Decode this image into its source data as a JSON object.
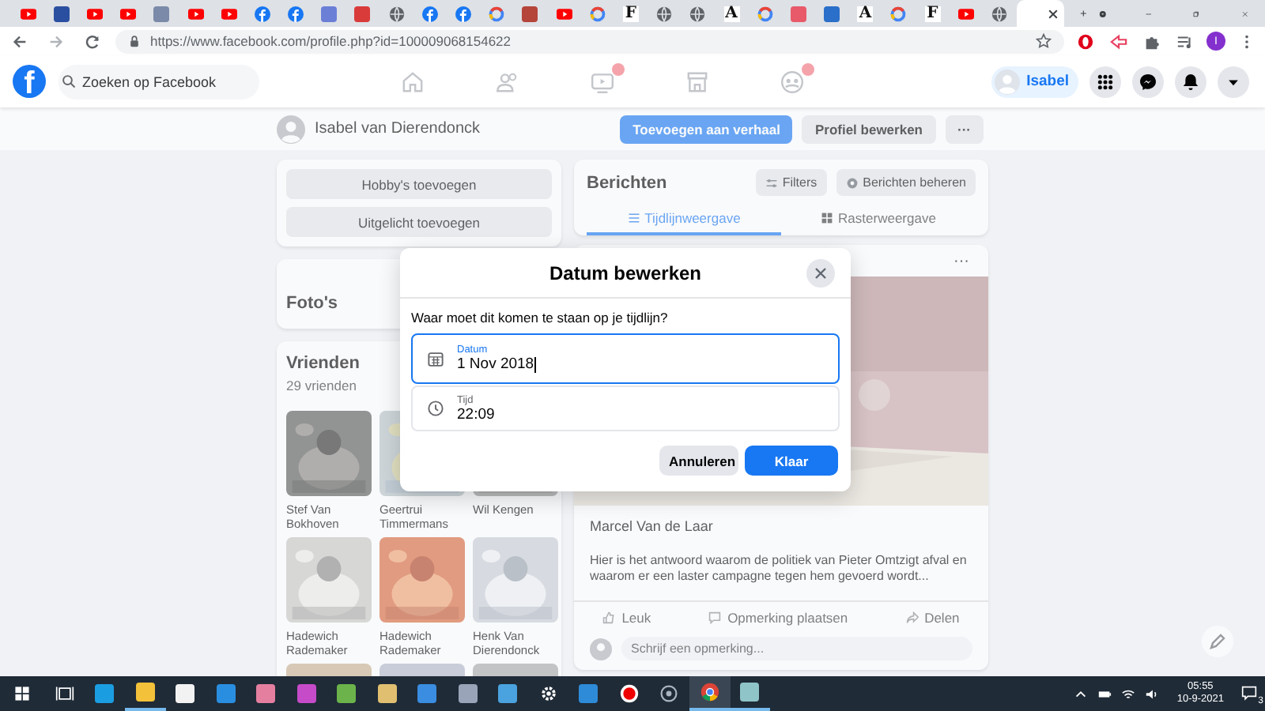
{
  "browser": {
    "tabs": [
      {
        "kind": "youtube",
        "selected": false
      },
      {
        "kind": "app",
        "color": "#2b4fa0",
        "selected": false
      },
      {
        "kind": "youtube",
        "selected": false
      },
      {
        "kind": "youtube",
        "selected": false
      },
      {
        "kind": "app",
        "color": "#7a8aa8",
        "selected": false
      },
      {
        "kind": "youtube",
        "selected": false
      },
      {
        "kind": "youtube",
        "selected": false
      },
      {
        "kind": "facebook",
        "selected": false
      },
      {
        "kind": "facebook",
        "selected": false
      },
      {
        "kind": "app",
        "color": "#6b7fd7",
        "selected": false
      },
      {
        "kind": "app",
        "color": "#d93b3b",
        "selected": false
      },
      {
        "kind": "globe",
        "selected": false
      },
      {
        "kind": "facebook",
        "selected": false
      },
      {
        "kind": "facebook",
        "selected": false
      },
      {
        "kind": "google",
        "selected": false
      },
      {
        "kind": "app",
        "color": "#b5443a",
        "selected": false
      },
      {
        "kind": "youtube",
        "selected": false
      },
      {
        "kind": "google",
        "selected": false
      },
      {
        "kind": "letter",
        "glyph": "F",
        "selected": false
      },
      {
        "kind": "globe",
        "selected": false
      },
      {
        "kind": "globe",
        "selected": false
      },
      {
        "kind": "letter",
        "glyph": "A",
        "selected": false
      },
      {
        "kind": "google",
        "selected": false
      },
      {
        "kind": "app",
        "color": "#e85a6a",
        "selected": false
      },
      {
        "kind": "app",
        "color": "#2a6fc9",
        "selected": false
      },
      {
        "kind": "letter",
        "glyph": "A",
        "selected": false
      },
      {
        "kind": "google",
        "selected": false
      },
      {
        "kind": "letter",
        "glyph": "F",
        "selected": false
      },
      {
        "kind": "youtube",
        "selected": false
      },
      {
        "kind": "globe",
        "selected": false
      },
      {
        "kind": "blank",
        "selected": true
      }
    ],
    "url": "https://www.facebook.com/profile.php?id=100009068154622",
    "profile_initial": "I"
  },
  "header": {
    "logo": "f",
    "search": {
      "placeholder": "Zoeken op Facebook"
    },
    "nav": [
      {
        "kind": "home",
        "badge": false
      },
      {
        "kind": "friends",
        "badge": false
      },
      {
        "kind": "watch",
        "badge": true
      },
      {
        "kind": "market",
        "badge": false
      },
      {
        "kind": "groups",
        "badge": true
      }
    ],
    "profile_name": "Isabel"
  },
  "profile_bar": {
    "name": "Isabel van Dierendonck",
    "buttons": [
      {
        "kind": "primary",
        "label": "Toevoegen aan verhaal"
      },
      {
        "kind": "secondary",
        "label": "Profiel bewerken"
      },
      {
        "kind": "more",
        "label": "···"
      }
    ]
  },
  "intro_buttons": [
    "Hobby's toevoegen",
    "Uitgelicht toevoegen"
  ],
  "photos_title": "Foto's",
  "friends": {
    "title": "Vrienden",
    "count": "29 vrienden",
    "items": [
      {
        "kind": "friend",
        "name": "Stef Van Bokhoven"
      },
      {
        "kind": "friend",
        "name": "Geertrui Timmermans"
      },
      {
        "kind": "friend",
        "name": "Wil Kengen"
      },
      {
        "kind": "friend",
        "name": "Hadewich Rademaker"
      },
      {
        "kind": "friend",
        "name": "Hadewich Rademaker"
      },
      {
        "kind": "friend",
        "name": "Henk Van Dierendonck"
      },
      {
        "kind": "picture"
      },
      {
        "kind": "picture"
      },
      {
        "kind": "picture"
      }
    ]
  },
  "posts": {
    "title": "Berichten",
    "actions": [
      {
        "kind": "filter",
        "label": "Filters"
      },
      {
        "kind": "gear",
        "label": "Berichten beheren"
      }
    ],
    "views": [
      {
        "kind": "list",
        "label": "Tijdlijnweergave",
        "selected": true
      },
      {
        "kind": "grid",
        "label": "Rasterweergave",
        "selected": false
      }
    ],
    "post": {
      "more": "···",
      "author": "Marcel Van de Laar",
      "text": "Hier is het antwoord waarom de politiek van Pieter Omtzigt afval en waarom er een laster campagne tegen hem gevoerd wordt...",
      "actions": [
        {
          "kind": "like",
          "label": "Leuk"
        },
        {
          "kind": "comment",
          "label": "Opmerking plaatsen"
        },
        {
          "kind": "share",
          "label": "Delen"
        }
      ],
      "comment_placeholder": "Schrijf een opmerking..."
    }
  },
  "dialog": {
    "title": "Datum bewerken",
    "prompt": "Waar moet dit komen te staan op je tijdlijn?",
    "fields": [
      {
        "kind": "date",
        "label": "Datum",
        "value": "1 Nov 2018",
        "focused": true
      },
      {
        "kind": "time",
        "label": "Tijd",
        "value": "22:09",
        "focused": false
      }
    ],
    "buttons": [
      {
        "kind": "secondary",
        "label": "Annuleren"
      },
      {
        "kind": "primary",
        "label": "Klaar"
      }
    ]
  },
  "taskbar": {
    "apps": [
      {
        "kind": "taskview",
        "running": false,
        "selected": false
      },
      {
        "kind": "app",
        "color": "#1b9de2",
        "running": false,
        "selected": false
      },
      {
        "kind": "app",
        "color": "#f3c13a",
        "running": true,
        "selected": false
      },
      {
        "kind": "app",
        "color": "#f2f2f2",
        "running": false,
        "selected": false
      },
      {
        "kind": "app",
        "color": "#2a8ee0",
        "running": false,
        "selected": false
      },
      {
        "kind": "app",
        "color": "#e47fa0",
        "running": false,
        "selected": false
      },
      {
        "kind": "app",
        "color": "#c54bc9",
        "running": false,
        "selected": false
      },
      {
        "kind": "app",
        "color": "#6bb34a",
        "running": false,
        "selected": false
      },
      {
        "kind": "app",
        "color": "#e0c070",
        "running": false,
        "selected": false
      },
      {
        "kind": "app",
        "color": "#3a8de0",
        "running": false,
        "selected": false
      },
      {
        "kind": "app",
        "color": "#9aa4b8",
        "running": false,
        "selected": false
      },
      {
        "kind": "app",
        "color": "#4aa3df",
        "running": false,
        "selected": false
      },
      {
        "kind": "gear",
        "running": false,
        "selected": false
      },
      {
        "kind": "app",
        "color": "#2e8bd8",
        "running": false,
        "selected": false
      },
      {
        "kind": "record",
        "running": false,
        "selected": false
      },
      {
        "kind": "ring",
        "running": false,
        "selected": false
      },
      {
        "kind": "chrome",
        "running": true,
        "selected": true
      },
      {
        "kind": "app",
        "color": "#8fc4c8",
        "running": true,
        "selected": false
      }
    ],
    "time": "05:55",
    "date": "10-9-2021",
    "notifications": "3"
  }
}
